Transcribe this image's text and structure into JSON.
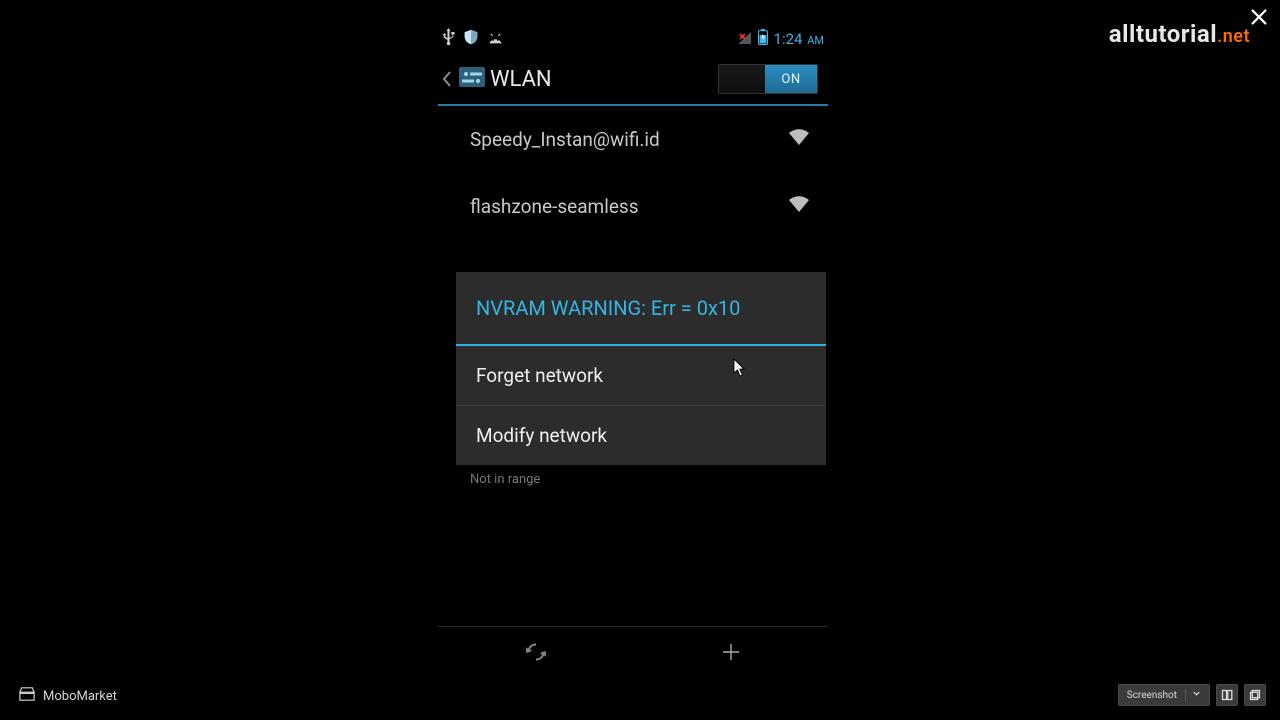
{
  "watermark": {
    "text": "alltutorial",
    "suffix": ".net"
  },
  "statusbar": {
    "time": "1:24",
    "ampm": "AM"
  },
  "actionbar": {
    "title": "WLAN",
    "toggle_state": "ON"
  },
  "networks": [
    {
      "ssid": "Speedy_Instan@wifi.id"
    },
    {
      "ssid": "flashzone-seamless"
    }
  ],
  "behind": {
    "ssid": "NVRAM WARNING: Err = 0x",
    "sub": "Not in range"
  },
  "dialog": {
    "title": "NVRAM WARNING: Err = 0x10",
    "items": [
      "Forget network",
      "Modify network"
    ]
  },
  "mobo": "MoboMarket",
  "toolbar": {
    "screenshot": "Screenshot"
  }
}
